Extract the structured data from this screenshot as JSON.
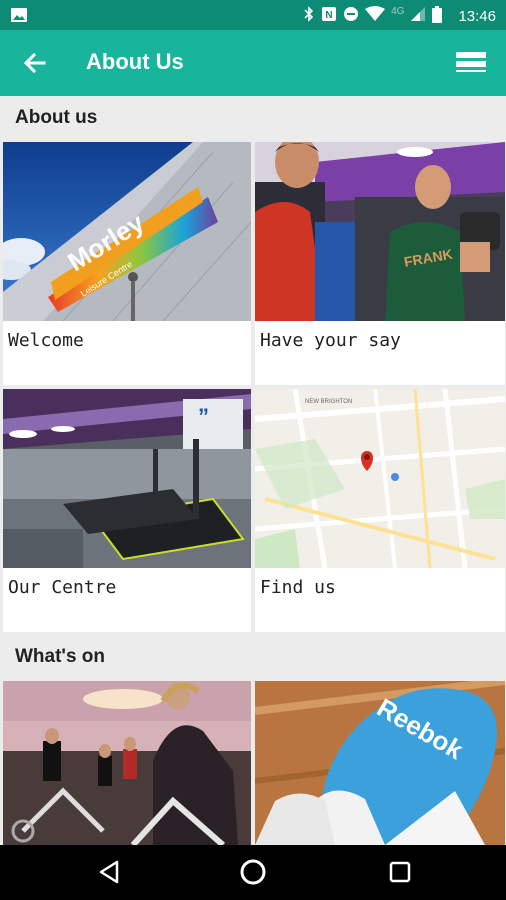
{
  "status_bar": {
    "time": "13:46",
    "network": "4G",
    "icons": [
      "image-icon",
      "bluetooth-icon",
      "nfc-icon",
      "do-not-disturb-icon",
      "wifi-icon",
      "signal-icon",
      "battery-icon"
    ]
  },
  "app_bar": {
    "title": "About Us",
    "back_icon": "arrow-left-icon",
    "menu_icon": "menu-icon",
    "background": "#19b49c",
    "status_background": "#0d8b74"
  },
  "sections": [
    {
      "title": "About us",
      "tiles": [
        {
          "label": "Welcome",
          "image": "morley-leisure-centre-sign"
        },
        {
          "label": "Have your say",
          "image": "gym-members-photo"
        },
        {
          "label": "Our Centre",
          "image": "gym-treadmills-photo"
        },
        {
          "label": "Find us",
          "image": "map-photo"
        }
      ]
    },
    {
      "title": "What's on",
      "tiles": [
        {
          "label": "",
          "image": "spin-class-photo"
        },
        {
          "label": "",
          "image": "reebok-boxing-glove-photo"
        }
      ]
    }
  ],
  "images_text": {
    "morley_sign": "Morley",
    "morley_sub": "Leisure Centre",
    "reebok": "Reebok",
    "map_area": "NEW BRIGHTON"
  },
  "nav_bar": {
    "icons": [
      "back-triangle-icon",
      "home-circle-icon",
      "recents-square-icon"
    ]
  }
}
